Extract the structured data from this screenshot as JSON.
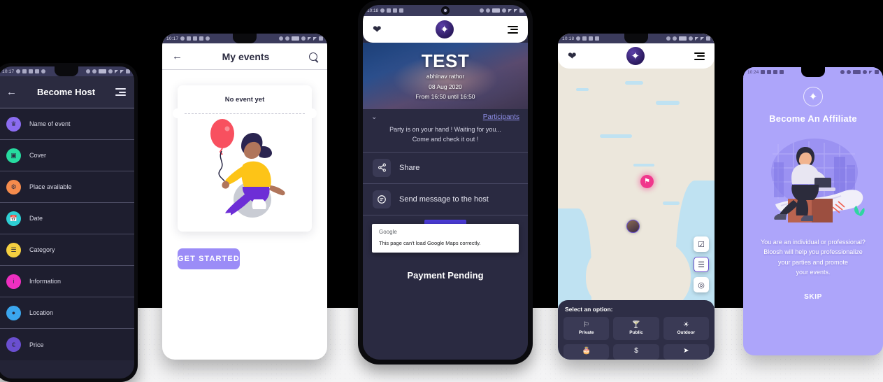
{
  "phones": {
    "become_host": {
      "status": {
        "time": "10:17"
      },
      "appbar": {
        "title": "Become Host",
        "back_icon": "arrow-left-icon",
        "menu_icon": "hamburger-icon"
      },
      "rows": [
        {
          "label": "Name of event",
          "color": "#8b6cf0",
          "icon": "trophy-icon"
        },
        {
          "label": "Cover",
          "color": "#27dba0",
          "icon": "image-icon"
        },
        {
          "label": "Place available",
          "color": "#f58b4c",
          "icon": "seat-icon"
        },
        {
          "label": "Date",
          "color": "#2ecfd4",
          "icon": "calendar-icon"
        },
        {
          "label": "Category",
          "color": "#f5d040",
          "icon": "sliders-icon"
        },
        {
          "label": "Information",
          "color": "#ee2fc0",
          "icon": "info-icon"
        },
        {
          "label": "Location",
          "color": "#3ba6ee",
          "icon": "pin-icon"
        },
        {
          "label": "Price",
          "color": "#6a4fd0",
          "icon": "euro-icon"
        }
      ]
    },
    "my_events": {
      "status": {
        "time": "10:17"
      },
      "appbar": {
        "title": "My events",
        "back_icon": "arrow-left-icon",
        "search_icon": "search-icon"
      },
      "ticket": {
        "empty_label": "No event yet"
      },
      "cta": {
        "label": "GET STARTED"
      }
    },
    "event_detail": {
      "status": {
        "time": "10:18"
      },
      "appbar": {
        "heart_icon": "heart-icon",
        "logo": "bloosh-logo",
        "menu_icon": "hamburger-icon"
      },
      "hero": {
        "title": "TEST",
        "host": "abhinav rathor",
        "date": "08 Aug 2020",
        "time_range": "From 16:50 until 16:50"
      },
      "participants_link": "Participants",
      "description_line1": "Party is on your hand ! Waiting for you...",
      "description_line2": "Come and check it out !",
      "actions": [
        {
          "label": "Share",
          "icon": "share-icon"
        },
        {
          "label": "Send message to the host",
          "icon": "message-icon"
        }
      ],
      "map_dialog": {
        "brand": "Google",
        "message": "This page can't load Google Maps correctly."
      },
      "payment_status": "Payment Pending"
    },
    "map": {
      "status": {
        "time": "10:18"
      },
      "appbar": {
        "heart_icon": "heart-icon",
        "logo": "bloosh-logo",
        "menu_icon": "hamburger-icon"
      },
      "fabs": [
        {
          "icon": "checklist-icon",
          "selected": false
        },
        {
          "icon": "filter-icon",
          "selected": true
        },
        {
          "icon": "locate-icon",
          "selected": false
        }
      ],
      "markers": [
        {
          "type": "flag-marker"
        },
        {
          "type": "avatar-marker"
        }
      ],
      "options": {
        "title": "Select an option:",
        "items": [
          {
            "label": "Private",
            "icon": "flag-icon"
          },
          {
            "label": "Public",
            "icon": "cocktail-icon"
          },
          {
            "label": "Outdoor",
            "icon": "campfire-icon"
          },
          {
            "label": "",
            "icon": "cake-icon"
          },
          {
            "label": "",
            "icon": "dollar-icon"
          },
          {
            "label": "",
            "icon": "rocket-icon"
          }
        ]
      }
    },
    "affiliate": {
      "status": {
        "time": "10:24"
      },
      "logo": "bloosh-logo",
      "title": "Become An Affiliate",
      "body_line1": "You are an individual or professional?",
      "body_line2": "Bloosh will help you professionalize",
      "body_line3": "your parties and promote",
      "body_line4": "your events.",
      "skip_label": "SKIP"
    }
  },
  "colors": {
    "accent_purple": "#9b8cf7",
    "dark_navy": "#2b2b40",
    "affiliate_bg": "#ada5fa",
    "marker_pink": "#f0378c"
  }
}
